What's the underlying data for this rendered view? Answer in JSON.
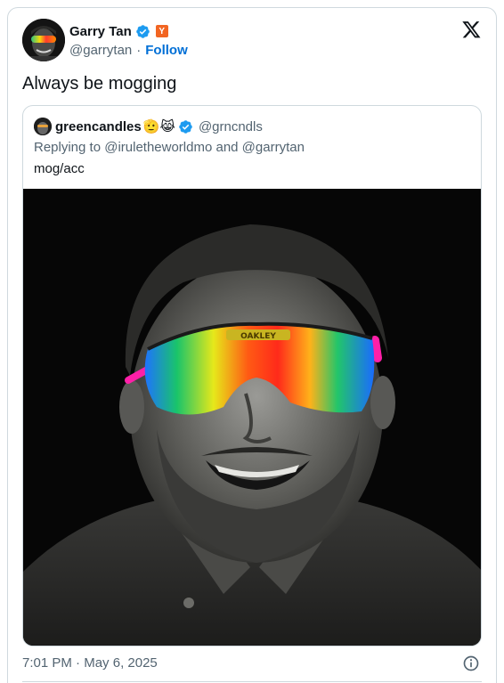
{
  "author": {
    "name": "Garry Tan",
    "handle": "@garrytan",
    "separator": "·",
    "follow_label": "Follow",
    "badge_letter": "Y"
  },
  "tweet": {
    "text": "Always be mogging",
    "time": "7:01 PM",
    "date": "May 6, 2025",
    "time_separator": "·"
  },
  "quote": {
    "name": "greencandles",
    "emojis": "🫡😹",
    "handle": "@grncndls",
    "replying": "Replying to @iruletheworldmo and @garrytan",
    "text": "mog/acc",
    "glasses_label": "OAKLEY"
  },
  "colors": {
    "link": "#006fd6",
    "verified": "#1d9bf0",
    "muted": "#536471",
    "border": "#cfd9de",
    "yc_badge": "#f26522"
  },
  "icons": {
    "verified": "verified-badge-icon",
    "x_logo": "x-logo-icon",
    "info": "info-icon"
  }
}
